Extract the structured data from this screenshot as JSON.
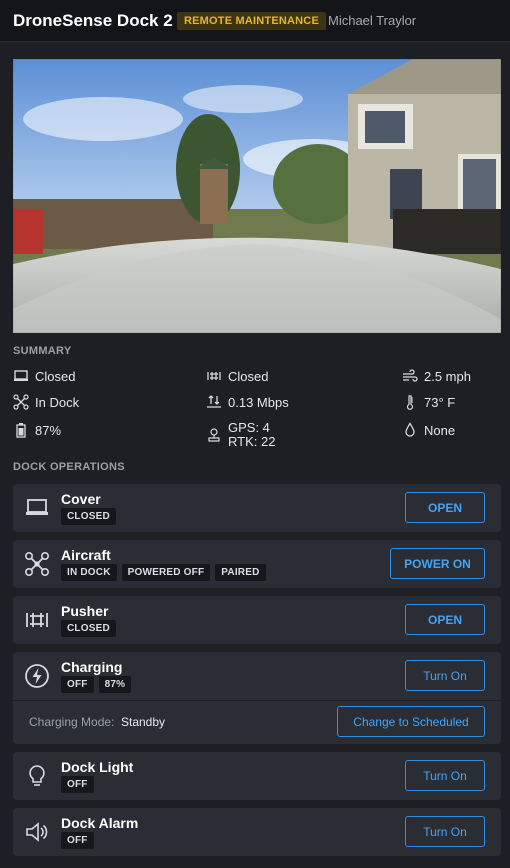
{
  "header": {
    "title": "DroneSense Dock 2",
    "badge": "REMOTE MAINTENANCE",
    "user": "Michael Traylor"
  },
  "summary": {
    "label": "SUMMARY",
    "cover_status": "Closed",
    "pusher_status": "Closed",
    "wind": "2.5 mph",
    "aircraft_status": "In Dock",
    "network": "0.13 Mbps",
    "temperature": "73° F",
    "battery": "87%",
    "gps": "GPS: 4",
    "rtk": "RTK: 22",
    "precipitation": "None"
  },
  "dock_operations": {
    "label": "DOCK OPERATIONS",
    "cover": {
      "name": "Cover",
      "tags": [
        "CLOSED"
      ],
      "button": "OPEN"
    },
    "aircraft": {
      "name": "Aircraft",
      "tags": [
        "IN DOCK",
        "POWERED OFF",
        "PAIRED"
      ],
      "button": "POWER ON"
    },
    "pusher": {
      "name": "Pusher",
      "tags": [
        "CLOSED"
      ],
      "button": "OPEN"
    },
    "charging": {
      "name": "Charging",
      "tags": [
        "OFF",
        "87%"
      ],
      "button": "Turn On",
      "mode_label": "Charging Mode:",
      "mode_value": "Standby",
      "mode_button": "Change to Scheduled"
    },
    "dock_light": {
      "name": "Dock Light",
      "tags": [
        "OFF"
      ],
      "button": "Turn On"
    },
    "dock_alarm": {
      "name": "Dock Alarm",
      "tags": [
        "OFF"
      ],
      "button": "Turn On"
    }
  },
  "colors": {
    "accent": "#2f8ee6",
    "badge": "#e7b62b",
    "background": "#1d1f24",
    "card": "#2a2d33"
  }
}
